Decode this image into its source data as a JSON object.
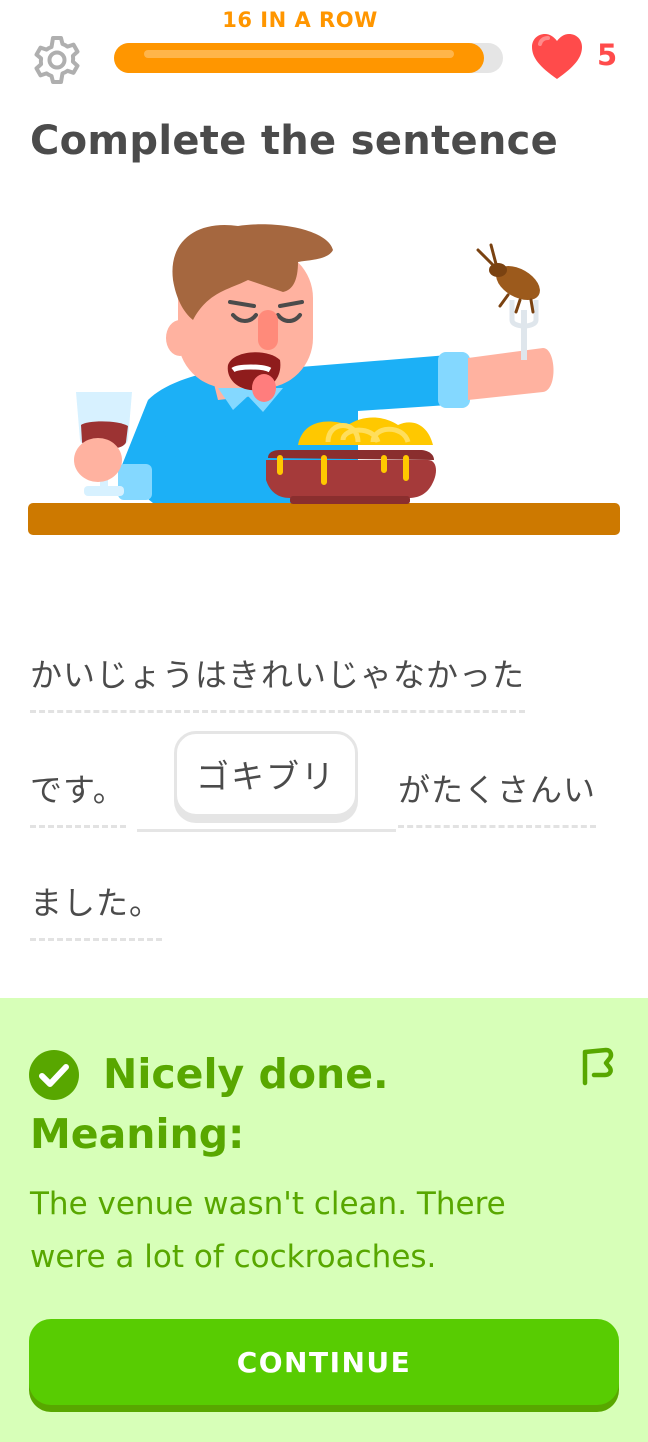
{
  "header": {
    "streak_label": "16 IN A ROW",
    "progress_fraction": 0.95,
    "hearts_count": "5",
    "colors": {
      "streak": "#ff9600",
      "heart": "#ff4b4b"
    }
  },
  "exercise": {
    "title": "Complete the sentence",
    "illustration": "man-eating-spaghetti-with-cockroach-on-fork",
    "sentence": {
      "line1": "かいじょうはきれいじゃなかった",
      "line2_before": "です。",
      "selected_word": "ゴキブリ",
      "line2_after": "がたくさんい",
      "line3": "ました。"
    }
  },
  "feedback": {
    "icon": "check-circle-icon",
    "status": "Nicely done.",
    "meaning_label": "Meaning:",
    "meaning_text": "The venue wasn't clean. There were a lot of cockroaches.",
    "flag_icon": "report-flag-icon",
    "continue_label": "CONTINUE",
    "colors": {
      "panel": "#d7ffb8",
      "text": "#58a700",
      "button": "#58cc02"
    }
  }
}
